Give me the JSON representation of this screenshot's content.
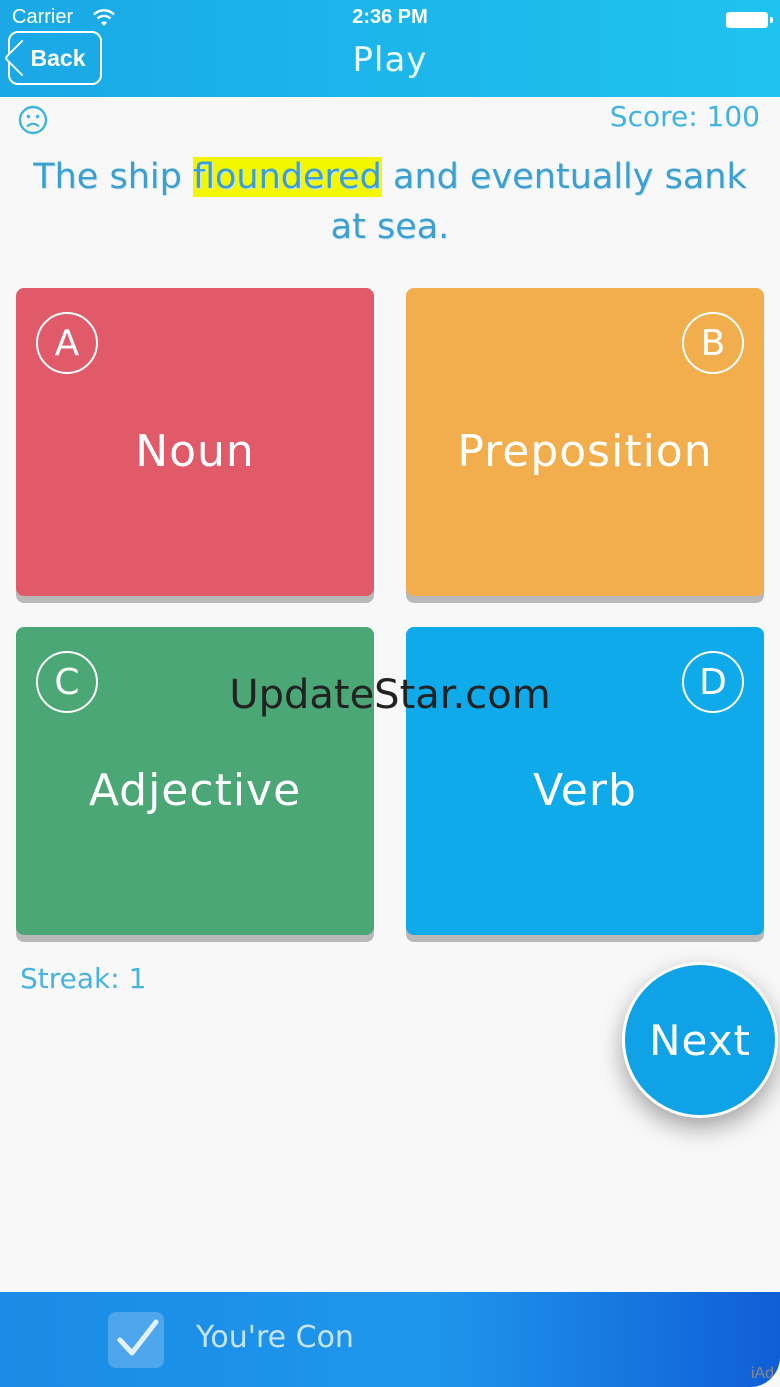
{
  "status_bar": {
    "carrier": "Carrier",
    "time": "2:36 PM"
  },
  "nav": {
    "back_label": "Back",
    "title": "Play"
  },
  "game": {
    "score_text": "Score: 100",
    "sentence_before": "The ship ",
    "highlighted_word": "floundered",
    "sentence_after": " and eventually sank at sea.",
    "streak_text": "Streak: 1"
  },
  "options": [
    {
      "letter": "A",
      "word": "Noun",
      "color": "#e05a6a"
    },
    {
      "letter": "B",
      "word": "Preposition",
      "color": "#f2ad4c"
    },
    {
      "letter": "C",
      "word": "Adjective",
      "color": "#4ca776"
    },
    {
      "letter": "D",
      "word": "Verb",
      "color": "#0eaaea"
    }
  ],
  "next_label": "Next",
  "watermark": "UpdateStar.com",
  "ad": {
    "text": "You're Con",
    "badge": "iAd"
  },
  "colors": {
    "nav_accent": "#1aa8e6",
    "text_accent": "#3b9fcf",
    "highlight": "#f3f700"
  }
}
